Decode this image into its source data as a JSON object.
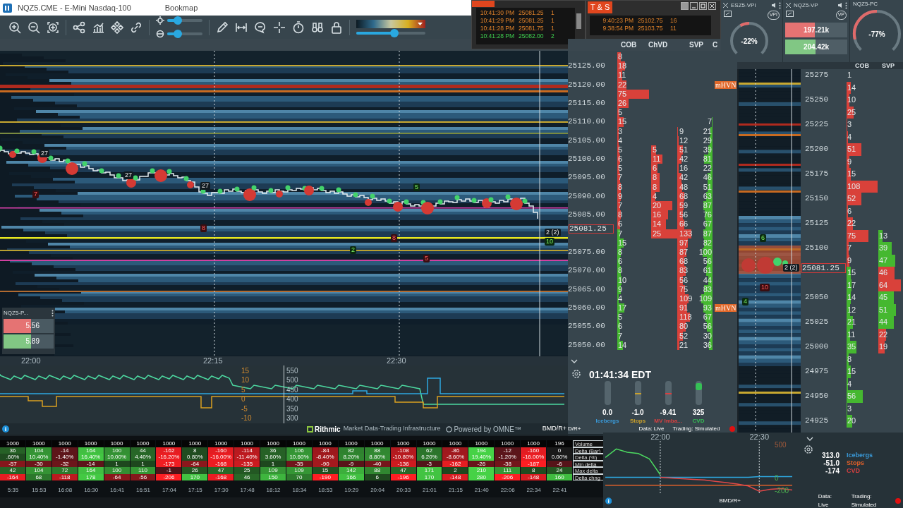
{
  "main_window": {
    "title": "NQZ5.CME - E-Mini Nasdaq-100",
    "app": "Bookmap"
  },
  "toolbar": {
    "brightness": {
      "level": 0.3
    },
    "contrast": {
      "level": 0.3
    },
    "palette": {
      "level": 0.55
    }
  },
  "heatmap": {
    "time_labels": [
      "22:00",
      "22:15",
      "22:30"
    ],
    "markers": [
      {
        "text": "27",
        "kind": "size"
      },
      {
        "text": "7",
        "kind": "sell"
      },
      {
        "text": "27",
        "kind": "size"
      },
      {
        "text": "27",
        "kind": "size"
      },
      {
        "text": "8",
        "kind": "sell"
      },
      {
        "text": "5",
        "kind": "buy"
      },
      {
        "text": "2",
        "kind": "buy"
      },
      {
        "text": "5",
        "kind": "sell"
      },
      {
        "text": "8",
        "kind": "sell"
      },
      {
        "text": "2 (2)",
        "kind": "size"
      },
      {
        "text": "10",
        "kind": "buy"
      }
    ],
    "indicator_left_ticks": [
      "15",
      "10",
      "5",
      "0",
      "-5",
      "-10"
    ],
    "indicator_right_ticks": [
      "550",
      "500",
      "450",
      "400",
      "350",
      "300"
    ]
  },
  "mini_widget": {
    "title": "NQZ5-P...",
    "sell": "5.56",
    "buy": "5.89"
  },
  "footer": {
    "provider": "Rithmic",
    "tagline": "Market Data·Trading Infrastructure",
    "powered": "Powered by OMNE™",
    "connection": "BMD/R+"
  },
  "delta_table": {
    "rows": [
      {
        "label": "Volume",
        "kind": "volume",
        "cells": [
          "1000",
          "1000",
          "1000",
          "1000",
          "1000",
          "1000",
          "1000",
          "1000",
          "1000",
          "1000",
          "1000",
          "1000",
          "1000",
          "1000",
          "1000",
          "1000",
          "1000",
          "1000",
          "1000",
          "1000",
          "1000",
          "196"
        ]
      },
      {
        "label": "Delta (Bar)",
        "kind": "delta",
        "cells": [
          "36",
          "104",
          "-14",
          "164",
          "100",
          "44",
          "-162",
          "8",
          "-160",
          "-114",
          "36",
          "106",
          "-84",
          "82",
          "88",
          "-108",
          "62",
          "-86",
          "194",
          "-12",
          "-160",
          "0"
        ]
      },
      {
        "label": "Delta (%)",
        "kind": "delta",
        "cells": [
          ".60%",
          "10.40%",
          "-1.40%",
          "16.40%",
          "10.00%",
          "4.40%",
          "-16.20%",
          "0.80%",
          "-16.00%",
          "-11.40%",
          "3.60%",
          "10.60%",
          "-8.40%",
          "8.20%",
          "8.80%",
          "-10.80%",
          "6.20%",
          "-8.60%",
          "19.40%",
          "-1.20%",
          "-16.00%",
          "0.00%"
        ]
      },
      {
        "label": "Min delta",
        "kind": "delta",
        "cells": [
          "-57",
          "-30",
          "-32",
          "-14",
          "1",
          "1",
          "-173",
          "-64",
          "-168",
          "-135",
          "1",
          "-35",
          "-90",
          "-9",
          "-40",
          "-136",
          "-3",
          "-162",
          "-26",
          "-38",
          "-187",
          "-6"
        ]
      },
      {
        "label": "Max delta",
        "kind": "delta",
        "cells": [
          "42",
          "104",
          "72",
          "164",
          "100",
          "110",
          "-1",
          "26",
          "47",
          "25",
          "109",
          "109",
          "15",
          "142",
          "88",
          "47",
          "171",
          "2",
          "210",
          "111",
          "8",
          "24"
        ]
      },
      {
        "label": "Delta chng",
        "kind": "delta",
        "cells": [
          "-164",
          "68",
          "-118",
          "178",
          "-64",
          "-56",
          "-206",
          "170",
          "-168",
          "46",
          "150",
          "70",
          "-190",
          "166",
          "6",
          "-196",
          "170",
          "-148",
          "280",
          "-206",
          "-148",
          "160"
        ]
      }
    ],
    "time_labels": [
      "5:35",
      "15:53",
      "16:08",
      "16:30",
      "16:41",
      "16:51",
      "17:04",
      "17:15",
      "17:30",
      "17:48",
      "18:12",
      "18:34",
      "18:53",
      "19:29",
      "20:04",
      "20:33",
      "21:01",
      "21:15",
      "21:40",
      "22:06",
      "22:34",
      "22:41"
    ]
  },
  "time_sales": [
    {
      "rows": [
        {
          "time": "10:41:30 PM",
          "price": "25081.25",
          "size": "1",
          "kind": "sell"
        },
        {
          "time": "10:41:29 PM",
          "price": "25081.25",
          "size": "1",
          "kind": "sell"
        },
        {
          "time": "10:41:28 PM",
          "price": "25081.75",
          "size": "1",
          "kind": "sell"
        },
        {
          "time": "10:41:28 PM",
          "price": "25082.00",
          "size": "2",
          "kind": "buy"
        }
      ]
    },
    {
      "title": "T & S",
      "rows": [
        {
          "time": "9:40:23 PM",
          "price": "25102.75",
          "size": "16",
          "kind": "sell"
        },
        {
          "time": "9:38:54 PM",
          "price": "25103.75",
          "size": "11",
          "kind": "sell"
        }
      ]
    }
  ],
  "ladder": {
    "columns": [
      "COB",
      "ChVD",
      "SVP",
      "C"
    ],
    "current_price": "25081.25",
    "asks": [
      {
        "cob": "8"
      },
      {
        "price": "25125.00",
        "cob": "18"
      },
      {
        "cob": "11"
      },
      {
        "price": "25120.00",
        "cob": "22",
        "tag": "mHVN"
      },
      {
        "cob": "75"
      },
      {
        "price": "25115.00",
        "cob": "26"
      },
      {
        "cob": "5"
      },
      {
        "price": "25110.00",
        "cob": "15",
        "svp_buy": "7"
      },
      {
        "cob": "3",
        "svp_sell": "9",
        "svp_buy": "21"
      },
      {
        "price": "25105.00",
        "cob": "4",
        "svp_sell": "12",
        "svp_buy": "29"
      },
      {
        "cob": "5",
        "chvd": "5",
        "svp_sell": "51",
        "svp_buy": "39"
      },
      {
        "price": "25100.00",
        "cob": "6",
        "chvd": "11",
        "svp_sell": "42",
        "svp_buy": "81"
      },
      {
        "cob": "5",
        "chvd": "6",
        "svp_sell": "16",
        "svp_buy": "22"
      },
      {
        "price": "25095.00",
        "cob": "7",
        "chvd": "8",
        "svp_sell": "42",
        "svp_buy": "46"
      },
      {
        "cob": "8",
        "chvd": "8",
        "svp_sell": "48",
        "svp_buy": "51"
      },
      {
        "price": "25090.00",
        "cob": "9",
        "chvd": "4",
        "svp_sell": "68",
        "svp_buy": "63"
      },
      {
        "cob": "7",
        "chvd": "20",
        "svp_sell": "59",
        "svp_buy": "87"
      },
      {
        "price": "25085.00",
        "cob": "8",
        "chvd": "16",
        "svp_sell": "56",
        "svp_buy": "76"
      },
      {
        "cob": "6",
        "chvd": "14",
        "svp_sell": "66",
        "svp_buy": "67"
      }
    ],
    "bids": [
      {
        "cob": "7",
        "chvd": "25",
        "svp_sell": "133",
        "svp_buy": "87"
      },
      {
        "cob": "15",
        "svp_sell": "97",
        "svp_buy": "82"
      },
      {
        "price": "25075.00",
        "cob": "8",
        "svp_sell": "87",
        "svp_buy": "100"
      },
      {
        "cob": "6",
        "svp_sell": "68",
        "svp_buy": "56"
      },
      {
        "price": "25070.00",
        "cob": "8",
        "svp_sell": "83",
        "svp_buy": "61"
      },
      {
        "cob": "10",
        "svp_sell": "56",
        "svp_buy": "44"
      },
      {
        "price": "25065.00",
        "cob": "9",
        "svp_sell": "75",
        "svp_buy": "83"
      },
      {
        "cob": "4",
        "svp_sell": "109",
        "svp_buy": "109"
      },
      {
        "price": "25060.00",
        "cob": "17",
        "svp_sell": "91",
        "svp_buy": "93",
        "tag": "mHVN"
      },
      {
        "cob": "5",
        "svp_sell": "118",
        "svp_buy": "67"
      },
      {
        "price": "25055.00",
        "cob": "6",
        "svp_sell": "80",
        "svp_buy": "56"
      },
      {
        "cob": "7",
        "svp_sell": "52",
        "svp_buy": "30"
      },
      {
        "price": "25050.00",
        "cob": "14",
        "svp_sell": "21",
        "svp_buy": "36"
      }
    ]
  },
  "widgets": {
    "vpi": {
      "title": "ESZ5-VPI",
      "badge": "VPI",
      "reading": "-22%"
    },
    "vp": {
      "title": "NQZ5-VP",
      "badge": "VP",
      "sell": {
        "reading": "197.21k",
        "level": 0.48
      },
      "buy": {
        "reading": "204.42k",
        "level": 0.49
      }
    },
    "pc": {
      "title": "NQZ5-PC",
      "reading": "-77%"
    }
  },
  "mini_heatmap": {
    "markers": [
      {
        "text": "6",
        "kind": "buy"
      },
      {
        "text": "10",
        "kind": "sell"
      },
      {
        "text": "4",
        "kind": "buy"
      },
      {
        "text": "2 (2)",
        "kind": "size"
      }
    ]
  },
  "right_ladder": {
    "columns": [
      "COB",
      "SVP"
    ],
    "current_price": "25081.25",
    "asks": [
      {
        "price": "25275",
        "cob": "1"
      },
      {
        "cob": "14"
      },
      {
        "price": "25250",
        "cob": "10"
      },
      {
        "cob": "25"
      },
      {
        "price": "25225",
        "cob": "3"
      },
      {
        "cob": "4"
      },
      {
        "price": "25200",
        "cob": "51"
      },
      {
        "cob": "9"
      },
      {
        "price": "25175",
        "cob": "15"
      },
      {
        "cob": "108"
      },
      {
        "price": "25150",
        "cob": "52"
      },
      {
        "cob": "6"
      },
      {
        "price": "25125",
        "cob": "22"
      },
      {
        "cob": "75",
        "svp": {
          "value": "13",
          "kind": "buy"
        }
      },
      {
        "price": "25100",
        "cob": "7",
        "svp": {
          "value": "39",
          "kind": "buy"
        }
      },
      {
        "cob": "9",
        "svp": {
          "value": "47",
          "kind": "buy"
        }
      }
    ],
    "bids": [
      {
        "cob": "15",
        "svp": {
          "value": "46",
          "kind": "sell"
        }
      },
      {
        "cob": "17",
        "svp": {
          "value": "64",
          "kind": "sell"
        }
      },
      {
        "price": "25050",
        "cob": "14",
        "svp": {
          "value": "45",
          "kind": "buy"
        }
      },
      {
        "cob": "12",
        "svp": {
          "value": "51",
          "kind": "buy"
        }
      },
      {
        "price": "25025",
        "cob": "21",
        "svp": {
          "value": "44",
          "kind": "buy"
        }
      },
      {
        "cob": "11",
        "svp": {
          "value": "22",
          "kind": "sell"
        }
      },
      {
        "price": "25000",
        "cob": "35",
        "svp": {
          "value": "19",
          "kind": "sell"
        }
      },
      {
        "cob": "8"
      },
      {
        "price": "24975",
        "cob": "15"
      },
      {
        "cob": "4"
      },
      {
        "price": "24950",
        "cob": "56"
      },
      {
        "cob": "3"
      },
      {
        "price": "24925",
        "cob": "20"
      }
    ]
  },
  "status_widget": {
    "clock": "01:41:34 EDT",
    "meters": [
      {
        "reading": "0.0",
        "label": "Icebergs",
        "color": "#3a9ad9",
        "kind": "empty"
      },
      {
        "reading": "-1.0",
        "label": "Stops",
        "color": "#c9a02c",
        "kind": "marker",
        "level": 0.5
      },
      {
        "reading": "-9.41",
        "label": "MV Imba...",
        "color": "#d84040",
        "kind": "marker",
        "level": 0.5
      },
      {
        "reading": "325",
        "label": "CVD",
        "color": "#35c055",
        "kind": "fill",
        "level": 0.3
      }
    ],
    "connection": "D/R+",
    "data": "Data: Live",
    "trading": "Trading: Simulated"
  },
  "cvd_panel": {
    "chart_data": {
      "type": "line",
      "categories": [
        null,
        null,
        null,
        null,
        null,
        "22:00",
        null,
        null,
        null,
        null,
        null,
        null,
        null,
        null,
        "22:30",
        null,
        null,
        null
      ],
      "yticks": [
        500,
        0,
        -200
      ],
      "ylim": [
        -250,
        550
      ],
      "series": [
        {
          "color": "#2ea8e0",
          "values": [
            0,
            0,
            0,
            0,
            0,
            0,
            0,
            0,
            0,
            0,
            0,
            0,
            0,
            0,
            10,
            10,
            10,
            10
          ]
        },
        {
          "color": "#e0602a",
          "values": [
            -120,
            -120,
            -120,
            -120,
            -120,
            -120,
            -120,
            -120,
            -120,
            -120,
            -120,
            -120,
            -120,
            -120,
            -120,
            -120,
            -120,
            -120
          ]
        },
        {
          "color": "#e04848",
          "values": [
            null,
            null,
            null,
            null,
            null,
            0,
            -10,
            -20,
            -30,
            -40,
            -60,
            -80,
            -100,
            -130,
            -210,
            -180,
            -170,
            -190
          ]
        },
        {
          "color": "#4cd860",
          "values": [
            300,
            430,
            380,
            360,
            280,
            40,
            null,
            null,
            null,
            null,
            null,
            null,
            null,
            null,
            null,
            null,
            null,
            null
          ]
        }
      ]
    },
    "legend": [
      {
        "reading": "313.0",
        "label": "Icebergs",
        "color": "#3a9ad9"
      },
      {
        "reading": "-51.0",
        "label": "Stops",
        "color": "#e0602a"
      },
      {
        "reading": "-174",
        "label": "CVD",
        "color": "#d84040"
      }
    ],
    "connection": "BMD/R+",
    "data": "Data: Live",
    "trading": "Trading: Simulated"
  }
}
